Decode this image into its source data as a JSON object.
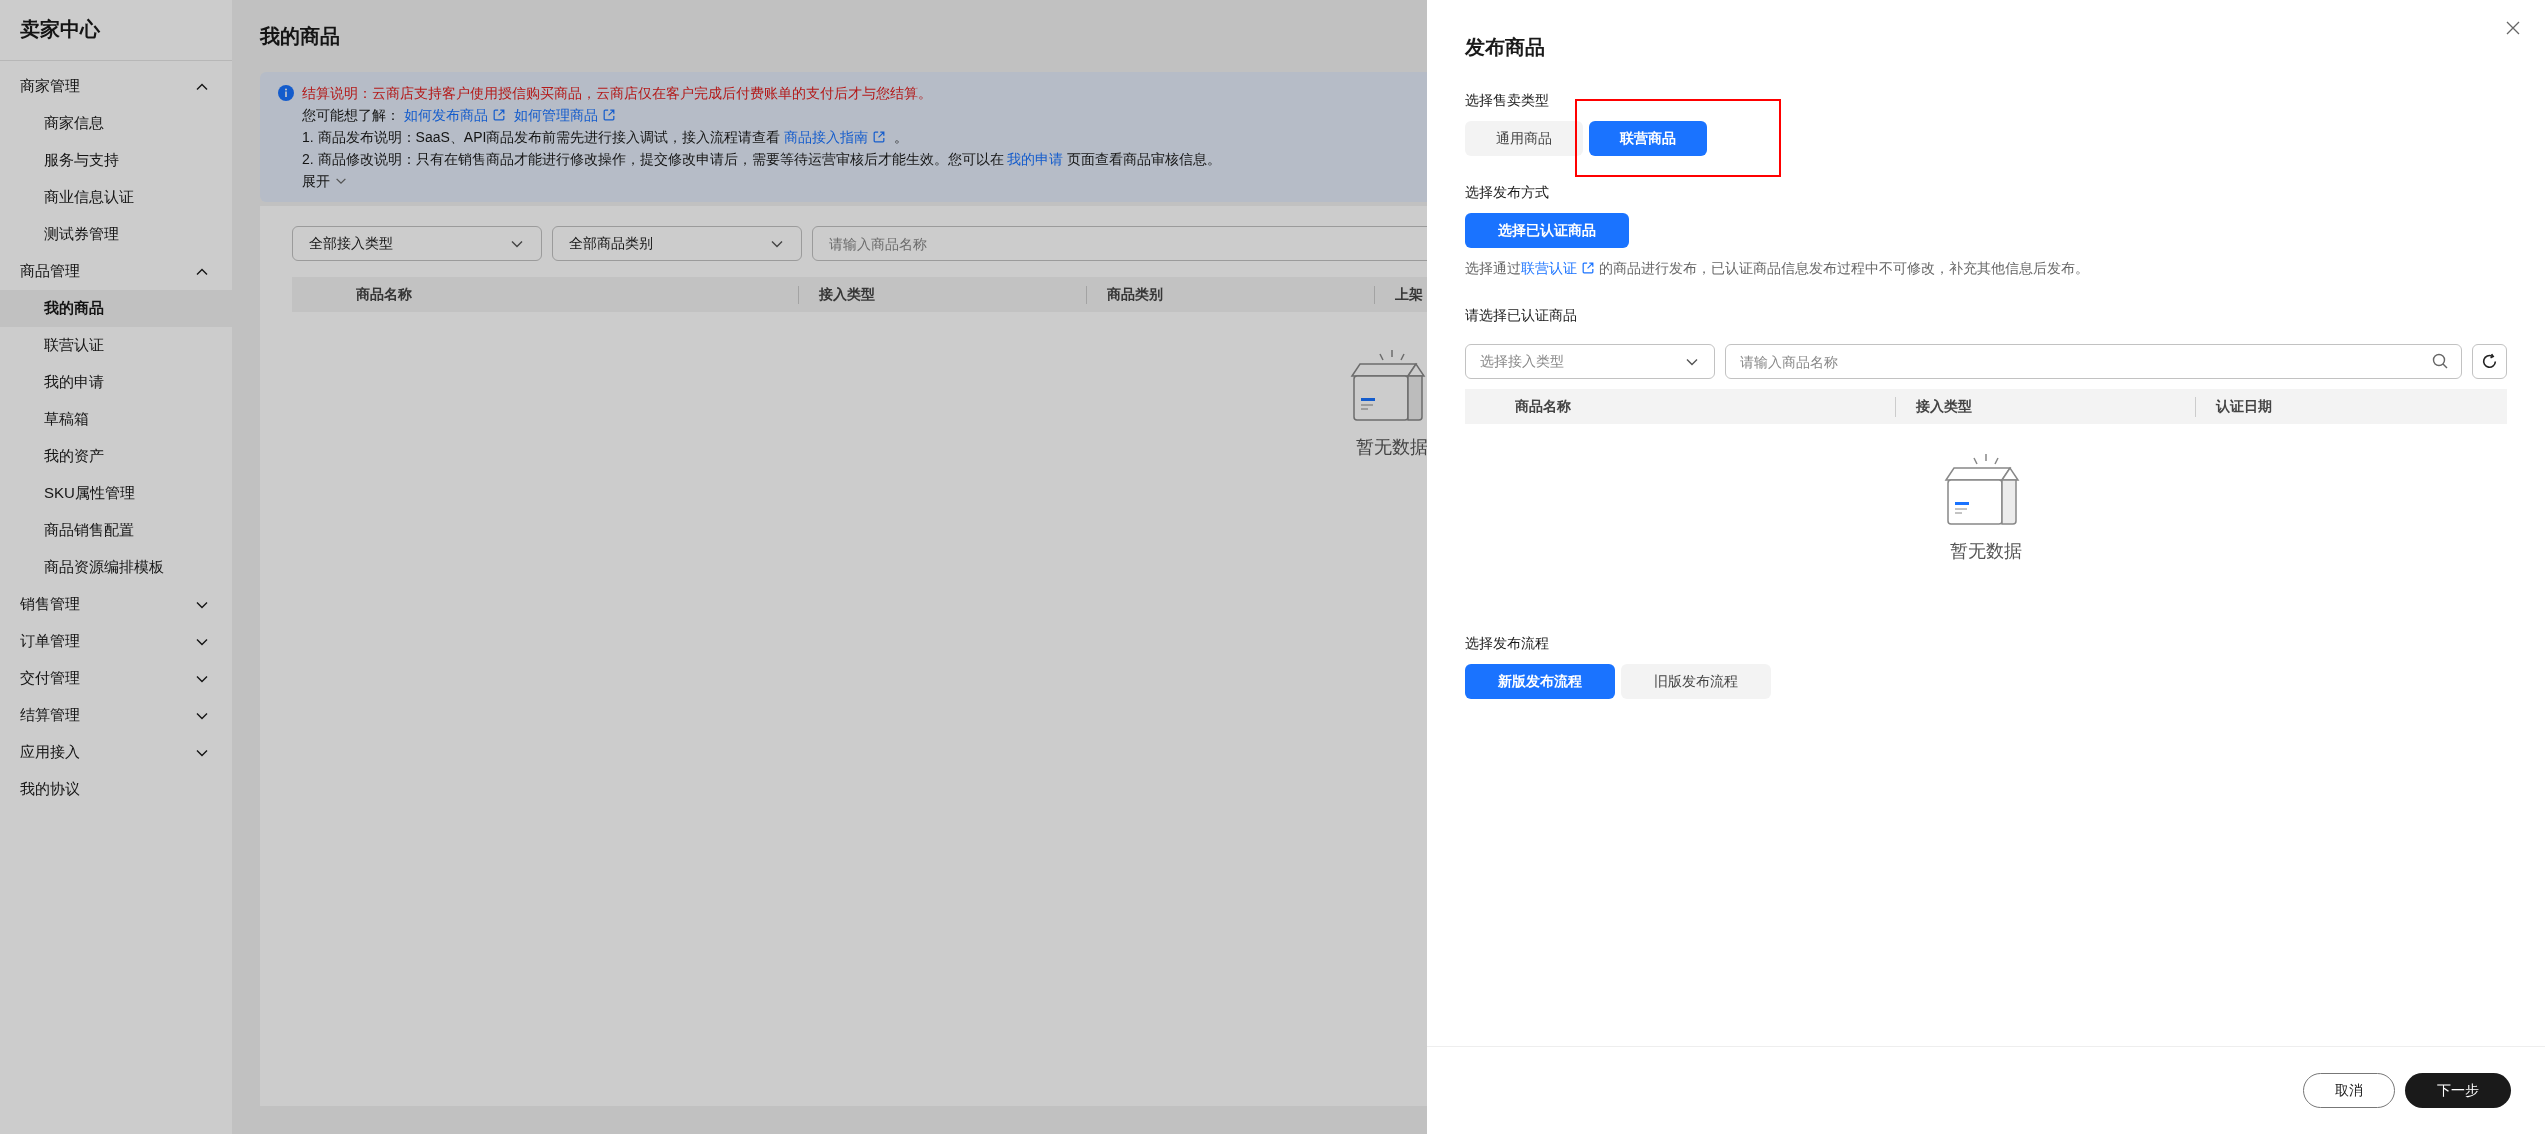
{
  "sidebar": {
    "title": "卖家中心",
    "items": [
      {
        "kind": "group",
        "label": "商家管理",
        "expanded": true,
        "children": [
          {
            "label": "商家信息",
            "selected": false
          },
          {
            "label": "服务与支持",
            "selected": false
          },
          {
            "label": "商业信息认证",
            "selected": false
          },
          {
            "label": "测试券管理",
            "selected": false
          }
        ]
      },
      {
        "kind": "group",
        "label": "商品管理",
        "expanded": true,
        "children": [
          {
            "label": "我的商品",
            "selected": true
          },
          {
            "label": "联营认证",
            "selected": false
          },
          {
            "label": "我的申请",
            "selected": false
          },
          {
            "label": "草稿箱",
            "selected": false
          },
          {
            "label": "我的资产",
            "selected": false
          },
          {
            "label": "SKU属性管理",
            "selected": false
          },
          {
            "label": "商品销售配置",
            "selected": false
          },
          {
            "label": "商品资源编排模板",
            "selected": false
          }
        ]
      },
      {
        "kind": "group",
        "label": "销售管理",
        "expanded": false
      },
      {
        "kind": "group",
        "label": "订单管理",
        "expanded": false
      },
      {
        "kind": "group",
        "label": "交付管理",
        "expanded": false
      },
      {
        "kind": "group",
        "label": "结算管理",
        "expanded": false
      },
      {
        "kind": "group",
        "label": "应用接入",
        "expanded": false
      },
      {
        "kind": "link",
        "label": "我的协议"
      }
    ]
  },
  "page": {
    "title": "我的商品",
    "notice": {
      "warning": "结算说明：云商店支持客户使用授信购买商品，云商店仅在客户完成后付费账单的支付后才与您结算。",
      "links_label": "您可能想了解：",
      "links": [
        "如何发布商品",
        "如何管理商品"
      ],
      "lines": [
        {
          "before": "1. 商品发布说明：SaaS、API商品发布前需先进行接入调试，接入流程请查看 ",
          "link": "商品接入指南",
          "external": true,
          "after": " 。"
        },
        {
          "before": "2. 商品修改说明：只有在销售商品才能进行修改操作，提交修改申请后，需要等待运营审核后才能生效。您可以在 ",
          "link": "我的申请",
          "external": false,
          "after": " 页面查看商品审核信息。"
        }
      ],
      "expand": "展开"
    },
    "filters": {
      "selects": [
        "全部接入类型",
        "全部商品类别"
      ],
      "search_placeholder": "请输入商品名称"
    },
    "table": {
      "columns": [
        "商品名称",
        "接入类型",
        "商品类别",
        "上架"
      ],
      "empty": "暂无数据"
    }
  },
  "drawer": {
    "title": "发布商品",
    "sale_type": {
      "label": "选择售卖类型",
      "options": [
        {
          "label": "通用商品",
          "selected": false
        },
        {
          "label": "联营商品",
          "selected": true
        }
      ]
    },
    "method": {
      "label": "选择发布方式",
      "button": "选择已认证商品",
      "hint_before": "选择通过",
      "hint_link": "联营认证",
      "hint_after": "的商品进行发布，已认证商品信息发布过程中不可修改，补充其他信息后发布。"
    },
    "certified": {
      "label": "请选择已认证商品",
      "type_placeholder": "选择接入类型",
      "search_placeholder": "请输入商品名称",
      "columns": [
        "商品名称",
        "接入类型",
        "认证日期"
      ],
      "empty": "暂无数据"
    },
    "flow": {
      "label": "选择发布流程",
      "options": [
        {
          "label": "新版发布流程",
          "selected": true
        },
        {
          "label": "旧版发布流程",
          "selected": false
        }
      ]
    },
    "footer": {
      "cancel": "取消",
      "next": "下一步"
    }
  }
}
